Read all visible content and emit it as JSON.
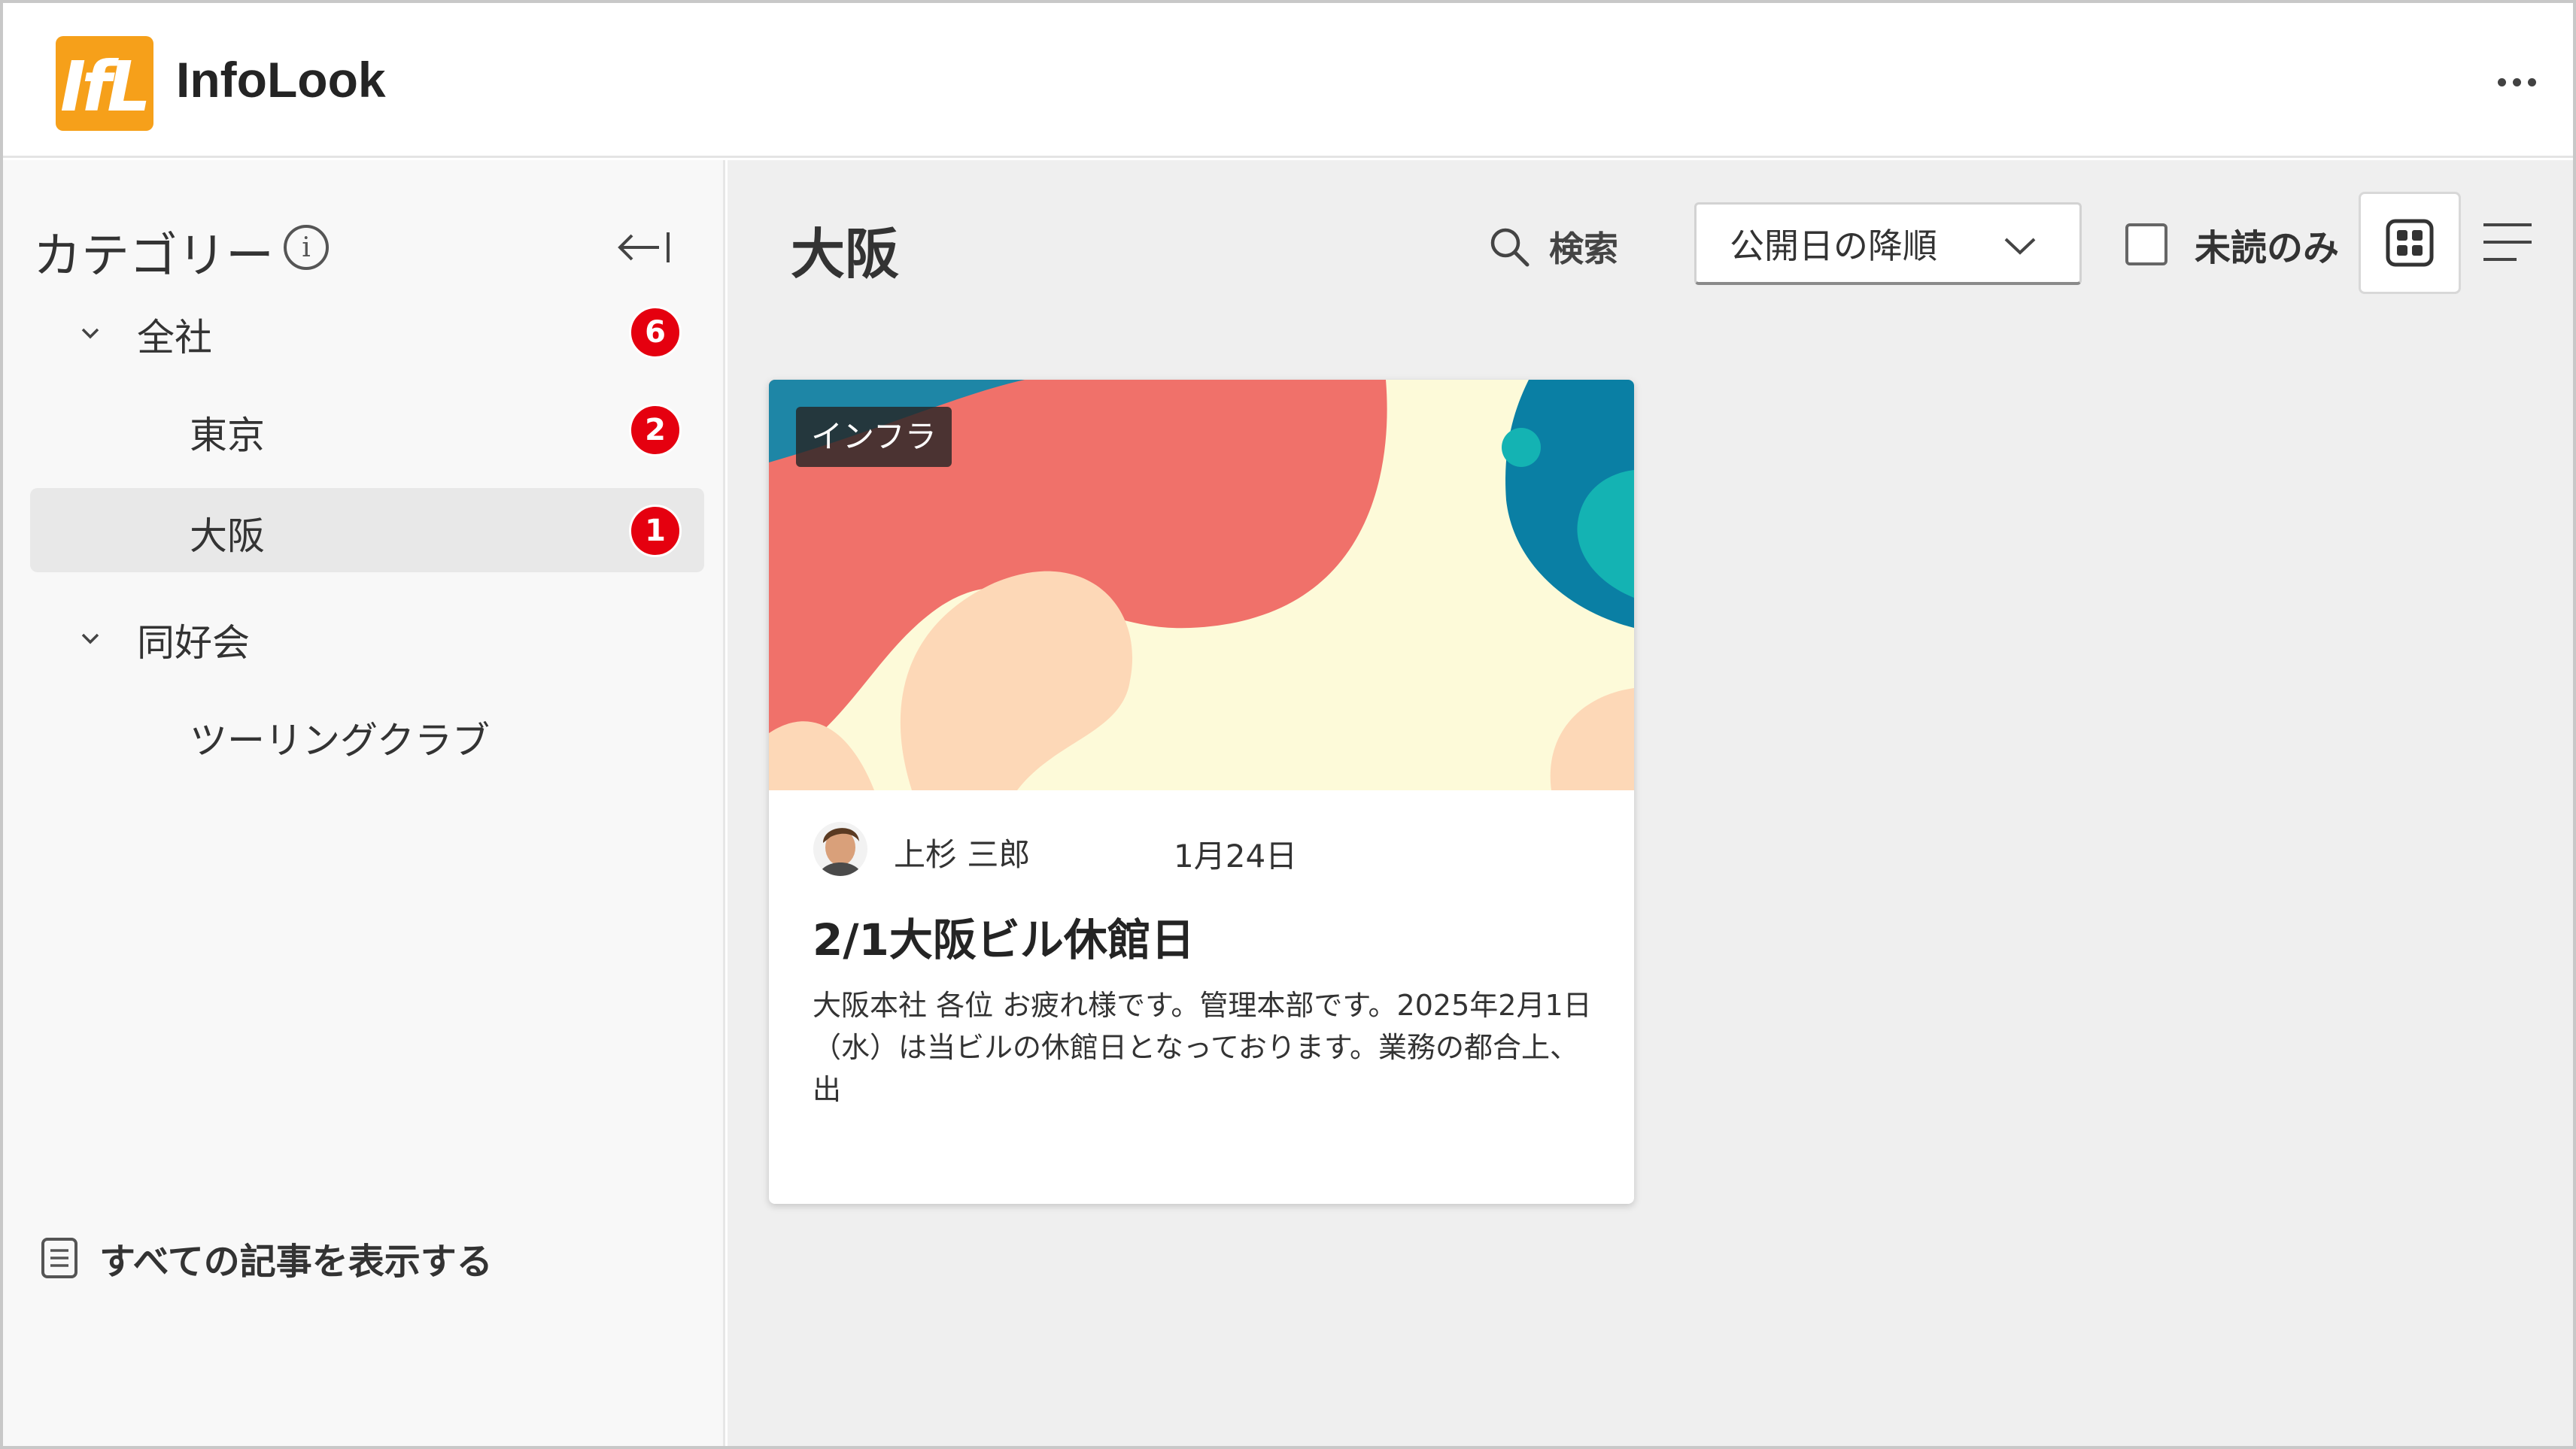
{
  "app": {
    "title": "InfoLook",
    "logo_text": "IfL",
    "brand_color": "#f6a01a"
  },
  "header": {
    "more_icon": "more-horizontal-icon"
  },
  "sidebar": {
    "title": "カテゴリー",
    "items": [
      {
        "label": "全社",
        "badge": "6",
        "expandable": true,
        "selected": false
      },
      {
        "label": "東京",
        "badge": "2",
        "expandable": false,
        "selected": false
      },
      {
        "label": "大阪",
        "badge": "1",
        "expandable": false,
        "selected": true
      },
      {
        "label": "同好会",
        "badge": "",
        "expandable": true,
        "selected": false
      },
      {
        "label": "ツーリングクラブ",
        "badge": "",
        "expandable": false,
        "selected": false
      }
    ],
    "all_articles_label": "すべての記事を表示する",
    "badge_color": "#e5000f"
  },
  "main": {
    "title": "大阪",
    "search_label": "検索",
    "sort": {
      "selected": "公開日の降順"
    },
    "unread_only_label": "未読のみ",
    "unread_only_checked": false,
    "view_mode": "grid"
  },
  "cards": [
    {
      "tag": "インフラ",
      "author": "上杉 三郎",
      "date": "1月24日",
      "title": "2/1大阪ビル休館日",
      "excerpt": "大阪本社 各位 お疲れ様です。管理本部です。2025年2月1日（水）は当ビルの休館日となっております。業務の都合上、出"
    }
  ]
}
